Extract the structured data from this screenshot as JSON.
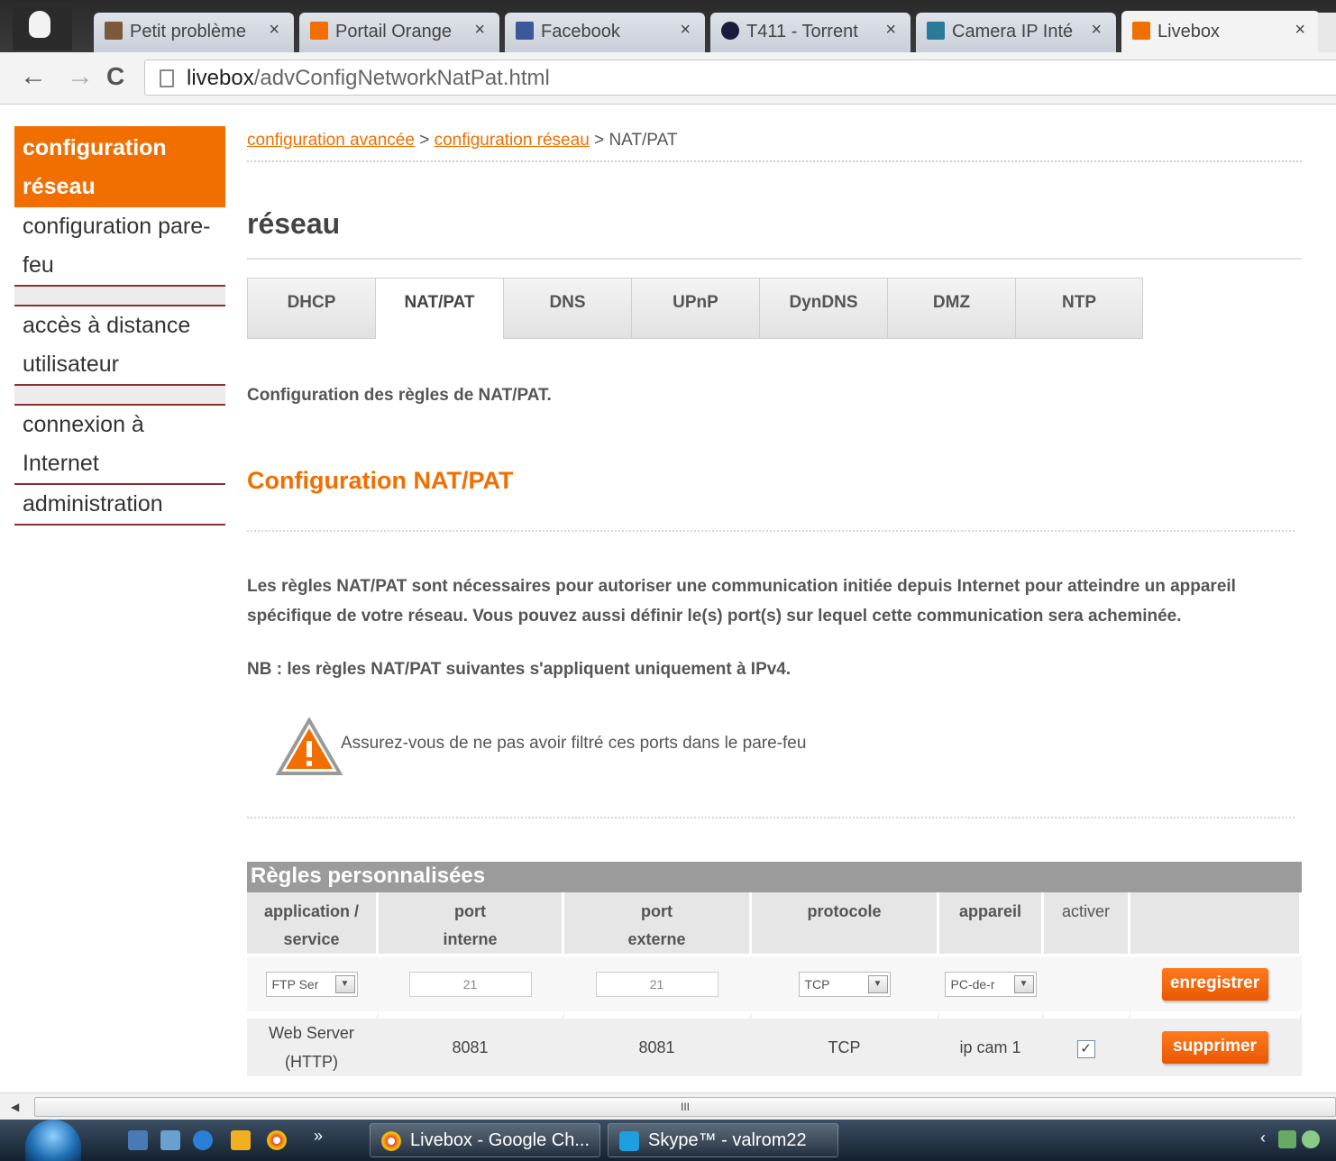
{
  "browser": {
    "tabs": [
      {
        "title": "Petit problème",
        "favicon_color": "#7a5a3a"
      },
      {
        "title": "Portail Orange",
        "favicon_color": "#f16e00"
      },
      {
        "title": "Facebook",
        "favicon_color": "#3b5998"
      },
      {
        "title": "T411 - Torrent",
        "favicon_color": "#1a1a3a"
      },
      {
        "title": "Camera IP Inté",
        "favicon_color": "#2a7a9a"
      },
      {
        "title": "Livebox",
        "favicon_color": "#f16e00"
      }
    ],
    "close_glyph": "×",
    "url_host": "livebox",
    "url_path": "/advConfigNetworkNatPat.html"
  },
  "sidebar": {
    "items": [
      {
        "label": "configuration réseau"
      },
      {
        "label": "configuration pare-feu"
      },
      {
        "label": "accès à distance utilisateur"
      },
      {
        "label": "connexion à Internet"
      },
      {
        "label": "administration"
      }
    ]
  },
  "breadcrumb": {
    "link1": "configuration avancée",
    "link2": "configuration réseau",
    "separator": ">",
    "current": "NAT/PAT"
  },
  "page_title": "réseau",
  "tabs": [
    "DHCP",
    "NAT/PAT",
    "DNS",
    "UPnP",
    "DynDNS",
    "DMZ",
    "NTP"
  ],
  "intro": "Configuration des règles de NAT/PAT.",
  "section_title": "Configuration NAT/PAT",
  "description": "Les règles NAT/PAT sont nécessaires pour autoriser une communication initiée depuis Internet pour atteindre un appareil spécifique de votre réseau. Vous pouvez aussi définir le(s) port(s) sur lequel cette communication sera acheminée.",
  "nb": "NB : les règles NAT/PAT suivantes s'appliquent uniquement à IPv4.",
  "warning": "Assurez-vous de ne pas avoir filtré ces ports dans le pare-feu",
  "rules": {
    "title": "Règles personnalisées",
    "headers": {
      "app_line1": "application /",
      "app_line2": "service",
      "int_line1": "port",
      "int_line2": "interne",
      "ext_line1": "port",
      "ext_line2": "externe",
      "protocol": "protocole",
      "device": "appareil",
      "activate": "activer"
    },
    "new_rule": {
      "service": "FTP Ser",
      "port_internal": "21",
      "port_external": "21",
      "protocol": "TCP",
      "device": "PC-de-r",
      "save_label": "enregistrer"
    },
    "rows": [
      {
        "service_line1": "Web Server",
        "service_line2": "(HTTP)",
        "port_internal": "8081",
        "port_external": "8081",
        "protocol": "TCP",
        "device": "ip cam 1",
        "checked_glyph": "✓",
        "delete_label": "supprimer"
      }
    ]
  },
  "scrollbar": {
    "grip": "III"
  },
  "taskbar": {
    "buttons": [
      {
        "label": "Livebox - Google Ch..."
      },
      {
        "label": "Skype™ - valrom22"
      }
    ],
    "more_glyph": "»"
  },
  "colors": {
    "orange": "#f16e00",
    "table_header": "#9b9b9b"
  }
}
